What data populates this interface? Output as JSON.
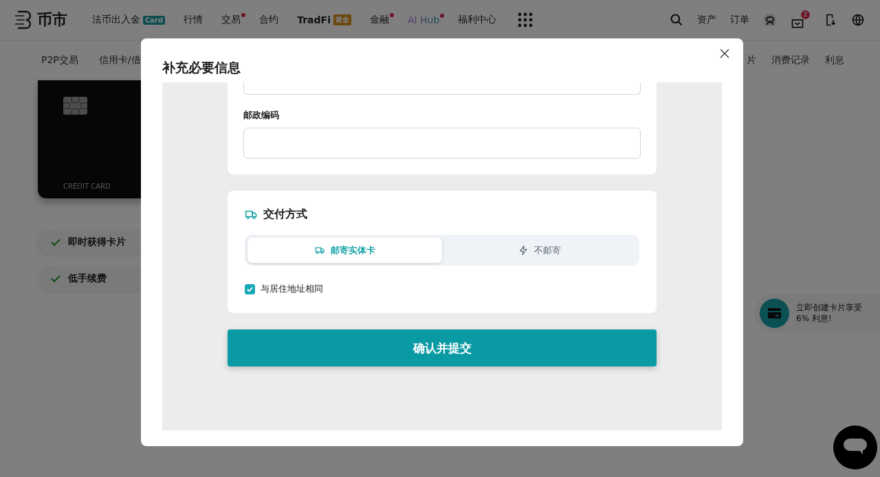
{
  "header": {
    "logo": "币市",
    "nav": [
      {
        "label": "法币出入金",
        "kind": "plain",
        "dot": false,
        "badge": {
          "text": "Card",
          "kind": "teal"
        }
      },
      {
        "label": "行情",
        "kind": "plain",
        "dot": false
      },
      {
        "label": "交易",
        "kind": "plain",
        "dot": true
      },
      {
        "label": "合约",
        "kind": "plain",
        "dot": false
      },
      {
        "label": "TradFi",
        "kind": "bold",
        "dot": false,
        "badge": {
          "text": "黄金",
          "kind": "gold"
        }
      },
      {
        "label": "金融",
        "kind": "plain",
        "dot": true
      },
      {
        "label": "AI Hub",
        "kind": "gradient",
        "dot": true
      },
      {
        "label": "福利中心",
        "kind": "plain",
        "dot": false
      }
    ],
    "links": [
      "资产",
      "订单"
    ],
    "mail_count": "2"
  },
  "subnav": {
    "left": [
      "P2P交易",
      "信用卡/借"
    ],
    "right": [
      "片",
      "消费记录",
      "利息"
    ]
  },
  "card": {
    "label": "CREDIT CARD"
  },
  "features": [
    "即时获得卡片",
    "低手续费"
  ],
  "promo": {
    "text": "立即创建卡片享受 6% 利息!"
  },
  "modal": {
    "title": "补充必要信息",
    "postal": {
      "label": "邮政编码"
    },
    "delivery": {
      "title": "交付方式",
      "options": [
        {
          "label": "邮寄实体卡",
          "kind": "truck",
          "selected": true
        },
        {
          "label": "不邮寄",
          "kind": "bolt",
          "selected": false
        }
      ],
      "same_address": {
        "label": "与居住地址相同",
        "checked": true
      }
    },
    "submit": "确认并提交"
  }
}
